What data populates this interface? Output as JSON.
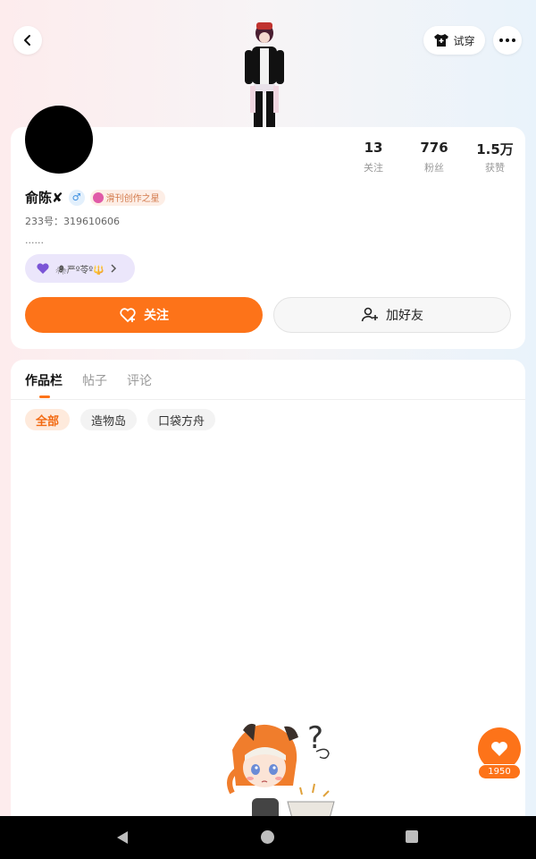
{
  "header": {
    "tryon_label": "试穿"
  },
  "profile": {
    "username": "俞陈✘",
    "gender_symbol": "♂",
    "title_badge": "滑刊创作之星",
    "uid_label": "233号：",
    "uid": "319610606",
    "bio": "......",
    "medal_text": "🕷严º苓º🔱",
    "stats": [
      {
        "value": "13",
        "label": "关注"
      },
      {
        "value": "776",
        "label": "粉丝"
      },
      {
        "value": "1.5万",
        "label": "获赞"
      }
    ],
    "follow_label": "关注",
    "add_friend_label": "加好友"
  },
  "tabs": [
    {
      "label": "作品栏",
      "active": true
    },
    {
      "label": "帖子",
      "active": false
    },
    {
      "label": "评论",
      "active": false
    }
  ],
  "filters": [
    {
      "label": "全部",
      "active": true
    },
    {
      "label": "造物岛",
      "active": false
    },
    {
      "label": "口袋方舟",
      "active": false
    }
  ],
  "like_count": "1950",
  "colors": {
    "accent": "#fd7319",
    "accent_light": "#feeadc",
    "medal_bg": "#ebe6fb"
  },
  "icons": [
    "back-icon",
    "shirt-icon",
    "more-icon",
    "heart-plus-icon",
    "add-user-icon",
    "heart-icon",
    "medal-heart-icon",
    "chevron-right-icon",
    "nav-back-icon",
    "nav-home-icon",
    "nav-recent-icon"
  ]
}
